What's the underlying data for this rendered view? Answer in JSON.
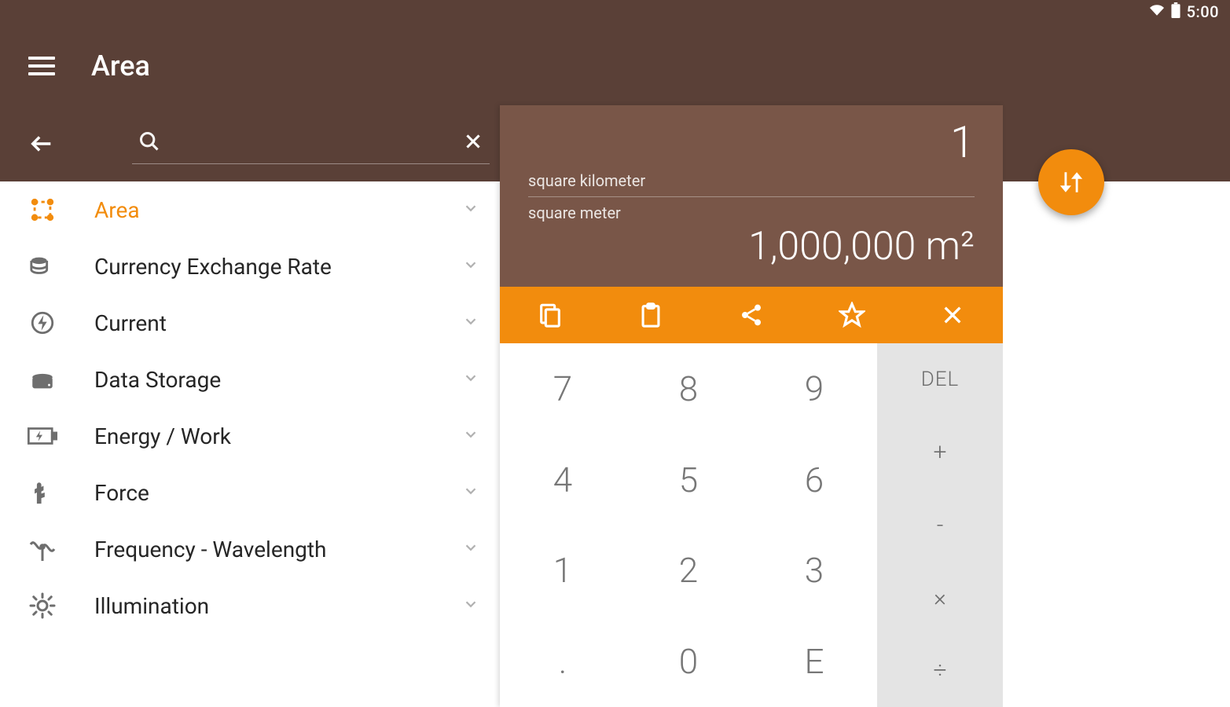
{
  "status_bar": {
    "time": "5:00"
  },
  "app_bar": {
    "title": "Area"
  },
  "categories": [
    {
      "id": "area",
      "label": "Area",
      "active": true
    },
    {
      "id": "currency",
      "label": "Currency Exchange Rate",
      "active": false
    },
    {
      "id": "current",
      "label": "Current",
      "active": false
    },
    {
      "id": "storage",
      "label": "Data Storage",
      "active": false
    },
    {
      "id": "energy",
      "label": "Energy / Work",
      "active": false
    },
    {
      "id": "force",
      "label": "Force",
      "active": false
    },
    {
      "id": "frequency",
      "label": "Frequency - Wavelength",
      "active": false
    },
    {
      "id": "illumination",
      "label": "Illumination",
      "active": false
    }
  ],
  "converter": {
    "input_value": "1",
    "from_unit": "square kilometer",
    "to_unit": "square meter",
    "output_value": "1,000,000 m²"
  },
  "keypad": {
    "digits": [
      "7",
      "8",
      "9",
      "4",
      "5",
      "6",
      "1",
      "2",
      "3",
      ".",
      "0",
      "E"
    ],
    "ops": {
      "del": "DEL",
      "plus": "+",
      "minus": "-",
      "times": "×",
      "divide": "÷"
    }
  },
  "colors": {
    "brand_dark": "#5a4037",
    "brand_mid": "#795648",
    "accent": "#f28c0d"
  }
}
